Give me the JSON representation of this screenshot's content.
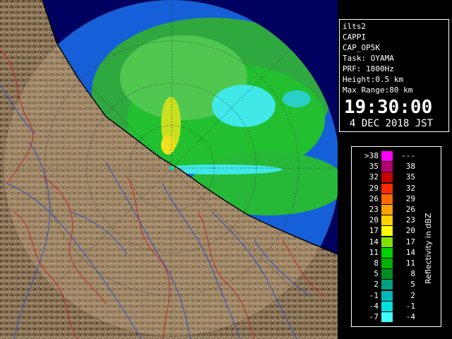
{
  "info": {
    "lines": [
      "ilts2",
      "CAPPI",
      "CAP_OP5K",
      "Task: OYAMA",
      "PRF: 1800Hz",
      "Height:0.5 km",
      "Max Range:80 km"
    ],
    "time": "19:30:00",
    "date": "4 DEC 2018 JST"
  },
  "legend": {
    "units": "Reflectivity in dBZ",
    "rows": [
      {
        "lo": ">38",
        "hi": "---",
        "color": "#ff00ff"
      },
      {
        "lo": "35",
        "hi": "38",
        "color": "#b40070"
      },
      {
        "lo": "32",
        "hi": "35",
        "color": "#c80000"
      },
      {
        "lo": "29",
        "hi": "32",
        "color": "#ff2a00"
      },
      {
        "lo": "26",
        "hi": "29",
        "color": "#ff6a00"
      },
      {
        "lo": "23",
        "hi": "26",
        "color": "#ffa000"
      },
      {
        "lo": "20",
        "hi": "23",
        "color": "#ffd200"
      },
      {
        "lo": "17",
        "hi": "20",
        "color": "#ffff00"
      },
      {
        "lo": "14",
        "hi": "17",
        "color": "#80e000"
      },
      {
        "lo": "11",
        "hi": "14",
        "color": "#00d000"
      },
      {
        "lo": "8",
        "hi": "11",
        "color": "#00b000"
      },
      {
        "lo": "5",
        "hi": "8",
        "color": "#008c20"
      },
      {
        "lo": "2",
        "hi": "5",
        "color": "#00a080"
      },
      {
        "lo": "-1",
        "hi": "2",
        "color": "#00b8b8"
      },
      {
        "lo": "-4",
        "hi": "-1",
        "color": "#00e0e0"
      },
      {
        "lo": "-7",
        "hi": "-4",
        "color": "#40ffff"
      }
    ]
  },
  "colors": {
    "sea_echo": "#1560d8",
    "land": "#8a7458",
    "echo_green": "#22c030",
    "echo_cyan": "#40e8e8",
    "echo_yellow": "#f0e020",
    "river": "#3050c8",
    "boundary": "#c02828"
  }
}
